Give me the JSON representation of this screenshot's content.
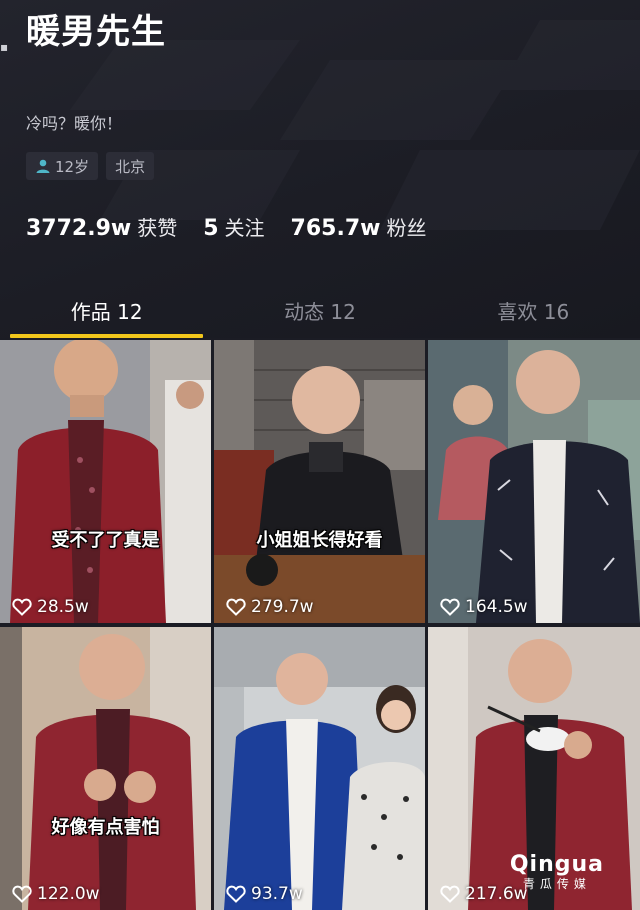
{
  "profile": {
    "name": "暖男先生",
    "bio": "冷吗？暖你！",
    "age": "12岁",
    "location": "北京"
  },
  "stats": {
    "likes_count": "3772.9w",
    "likes_label": "获赞",
    "following_count": "5",
    "following_label": "关注",
    "followers_count": "765.7w",
    "followers_label": "粉丝"
  },
  "tabs": [
    {
      "label": "作品 12",
      "active": true
    },
    {
      "label": "动态 12",
      "active": false
    },
    {
      "label": "喜欢 16",
      "active": false
    }
  ],
  "videos": [
    {
      "caption": "受不了了真是",
      "likes": "28.5w"
    },
    {
      "caption": "小姐姐长得好看",
      "likes": "279.7w"
    },
    {
      "caption": "",
      "likes": "164.5w"
    },
    {
      "caption": "好像有点害怕",
      "likes": "122.0w"
    },
    {
      "caption": "",
      "likes": "93.7w"
    },
    {
      "caption": "",
      "likes": "217.6w"
    }
  ],
  "watermark": {
    "main": "Qingua",
    "sub": "青瓜传媒"
  },
  "colors": {
    "accent": "#f2c71c",
    "background": "#1b1c24",
    "tag_bg": "#2c2d37"
  },
  "icons": {
    "age": "person-icon",
    "likes": "heart-outline-icon"
  }
}
